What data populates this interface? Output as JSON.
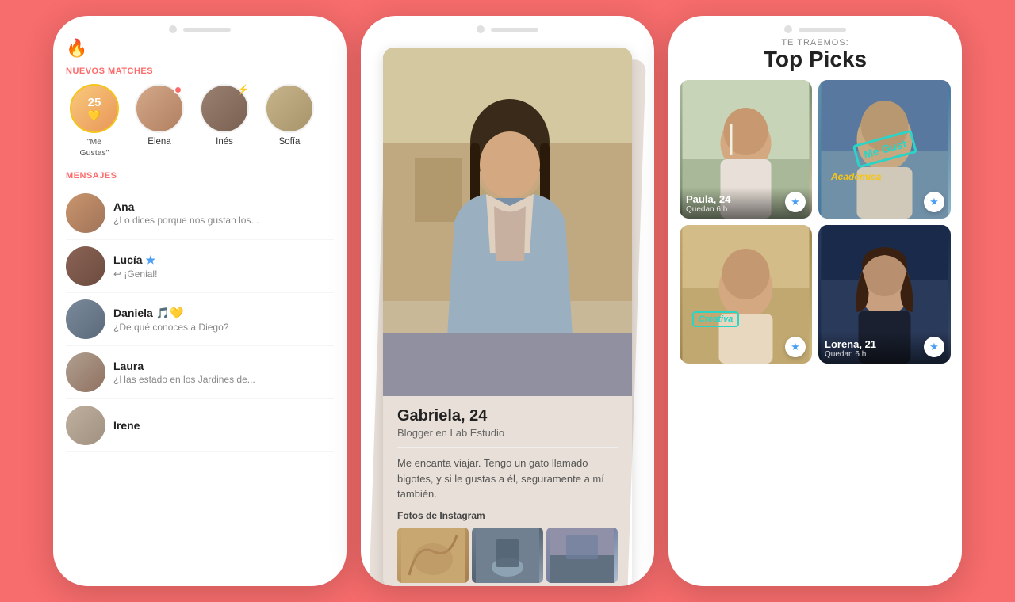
{
  "colors": {
    "background": "#f76c6c",
    "accent": "#fe6b6b",
    "star_blue": "#4a9ff5",
    "gold": "#f5c518",
    "teal": "#2cd4c8"
  },
  "phone1": {
    "flame_icon": "🔥",
    "new_matches_label": "NUEVOS MATCHES",
    "messages_label": "MENSAJES",
    "likes_count": "25",
    "likes_label": "\"Me\nGustas\"",
    "matches": [
      {
        "name": "Elena",
        "has_dot": true
      },
      {
        "name": "Inés",
        "has_bolt": true
      },
      {
        "name": "Sofía",
        "has_bolt": false
      }
    ],
    "messages": [
      {
        "name": "Ana",
        "preview": "¿Lo dices porque nos gustan los..."
      },
      {
        "name": "Lucía",
        "preview": "↩ ¡Genial!",
        "has_star": true
      },
      {
        "name": "Daniela",
        "preview": "¿De qué conoces a Diego?",
        "emoji": "🎵💛"
      },
      {
        "name": "Laura",
        "preview": "¿Has estado en los Jardines de..."
      },
      {
        "name": "Irene",
        "preview": ""
      }
    ]
  },
  "phone2": {
    "name": "Gabriela",
    "age": "24",
    "job": "Blogger en Lab Estudio",
    "bio": "Me encanta viajar. Tengo un gato llamado bigotes, y si le gustas a él, seguramente a mí también.",
    "instagram_label": "Fotos de Instagram"
  },
  "phone3": {
    "subtitle": "TE TRAEMOS:",
    "title": "Top Picks",
    "cards": [
      {
        "name": "Paula, 24",
        "time": "Quedan 6 h",
        "badge_type": "none",
        "bg": "paula"
      },
      {
        "name": "",
        "time": "",
        "badge": "Académica",
        "badge_type": "gold",
        "stamp": "Me Gust",
        "bg": "academic"
      },
      {
        "name": "",
        "time": "",
        "badge": "Creativa",
        "badge_type": "teal",
        "bg": "creativa"
      },
      {
        "name": "Lorena, 21",
        "time": "Quedan 6 h",
        "badge_type": "none",
        "bg": "lorena"
      }
    ]
  }
}
